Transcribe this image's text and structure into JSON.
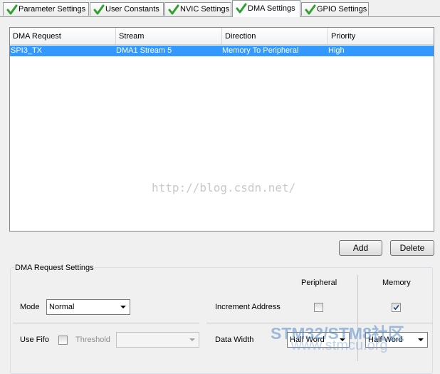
{
  "tabs": [
    {
      "label": "Parameter Settings",
      "active": false
    },
    {
      "label": "User Constants",
      "active": false
    },
    {
      "label": "NVIC Settings",
      "active": false
    },
    {
      "label": "DMA Settings",
      "active": true
    },
    {
      "label": "GPIO Settings",
      "active": false
    }
  ],
  "table": {
    "columns": [
      "DMA Request",
      "Stream",
      "Direction",
      "Priority"
    ],
    "rows": [
      {
        "request": "SPI3_TX",
        "stream": "DMA1 Stream 5",
        "direction": "Memory To Peripheral",
        "priority": "High",
        "selected": true
      }
    ]
  },
  "watermark": "http://blog.csdn.net/",
  "buttons": {
    "add": "Add",
    "delete": "Delete"
  },
  "settings": {
    "title": "DMA Request Settings",
    "peripheral_header": "Peripheral",
    "memory_header": "Memory",
    "mode_label": "Mode",
    "mode_value": "Normal",
    "increment_label": "Increment Address",
    "peripheral_increment": false,
    "memory_increment": true,
    "use_fifo_label": "Use Fifo",
    "use_fifo": false,
    "threshold_label": "Threshold",
    "threshold_value": "",
    "data_width_label": "Data Width",
    "peripheral_width": "Half Word",
    "memory_width": "Half Word"
  },
  "logo": {
    "line1": "STM32/STM8社区",
    "line2": "www.stmcu.org"
  },
  "colors": {
    "selection": "#3399ff",
    "check_green": "#2fa12f"
  }
}
